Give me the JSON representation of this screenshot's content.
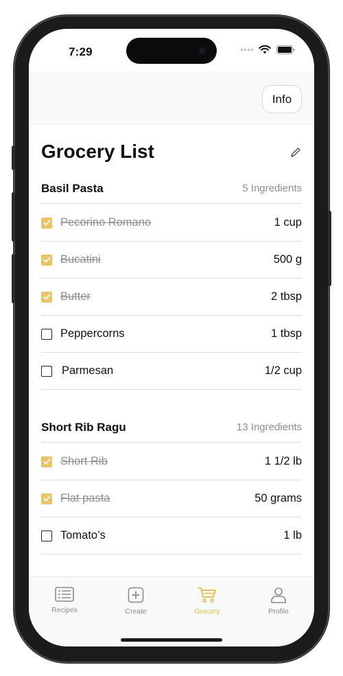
{
  "status_bar": {
    "time": "7:29"
  },
  "header": {
    "info_label": "Info"
  },
  "page": {
    "title": "Grocery List"
  },
  "sections": [
    {
      "title": "Basil Pasta",
      "count": "5 Ingredients",
      "items": [
        {
          "name": "Pecorino Romano",
          "qty": "1 cup",
          "checked": true
        },
        {
          "name": "Bucatini",
          "qty": "500 g",
          "checked": true
        },
        {
          "name": "Butter",
          "qty": "2 tbsp",
          "checked": true
        },
        {
          "name": "Peppercorns",
          "qty": "1 tbsp",
          "checked": false
        },
        {
          "name": "Parmesan",
          "qty": "1/2 cup",
          "checked": false
        }
      ]
    },
    {
      "title": "Short Rib Ragu",
      "count": "13 Ingredients",
      "items": [
        {
          "name": "Short Rib",
          "qty": "1 1/2 lb",
          "checked": true
        },
        {
          "name": "Flat pasta",
          "qty": "50 grams",
          "checked": true
        },
        {
          "name": "Tomato’s",
          "qty": "1 lb",
          "checked": false
        }
      ]
    }
  ],
  "tabbar": {
    "tabs": [
      {
        "label": "Recipes",
        "icon": "recipes-icon"
      },
      {
        "label": "Create",
        "icon": "plus-square-icon"
      },
      {
        "label": "Grocery",
        "icon": "cart-icon",
        "active": true
      },
      {
        "label": "Profile",
        "icon": "person-icon"
      }
    ]
  },
  "colors": {
    "accent": "#e9c46a",
    "muted": "#8e8e93",
    "divider": "#dedede"
  }
}
